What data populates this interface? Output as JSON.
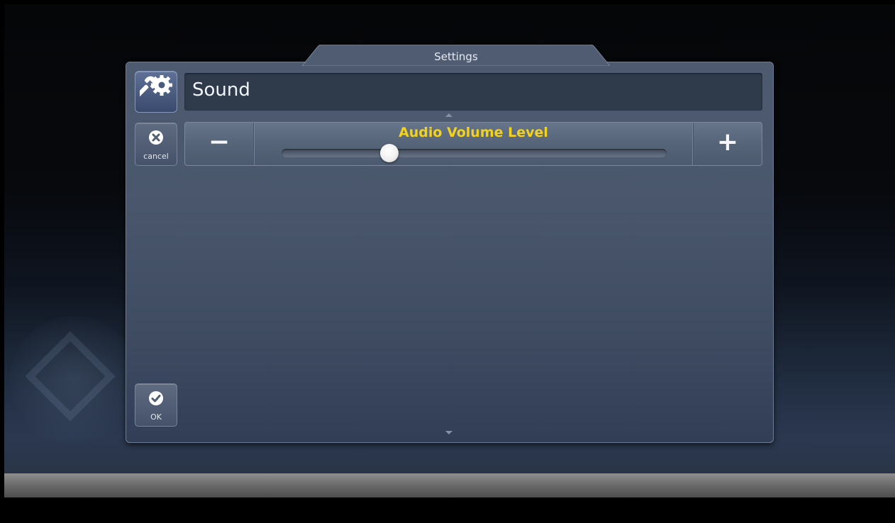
{
  "dialog": {
    "tab_title": "Settings",
    "section_title": "Sound",
    "section_icon": "wrench-gear-icon"
  },
  "buttons": {
    "cancel_label": "cancel",
    "ok_label": "OK",
    "minus_symbol": "−",
    "plus_symbol": "+"
  },
  "volume": {
    "label": "Audio Volume Level",
    "level": 0.28
  },
  "colors": {
    "label_accent": "#f2d21c",
    "panel": "#4a576c"
  }
}
